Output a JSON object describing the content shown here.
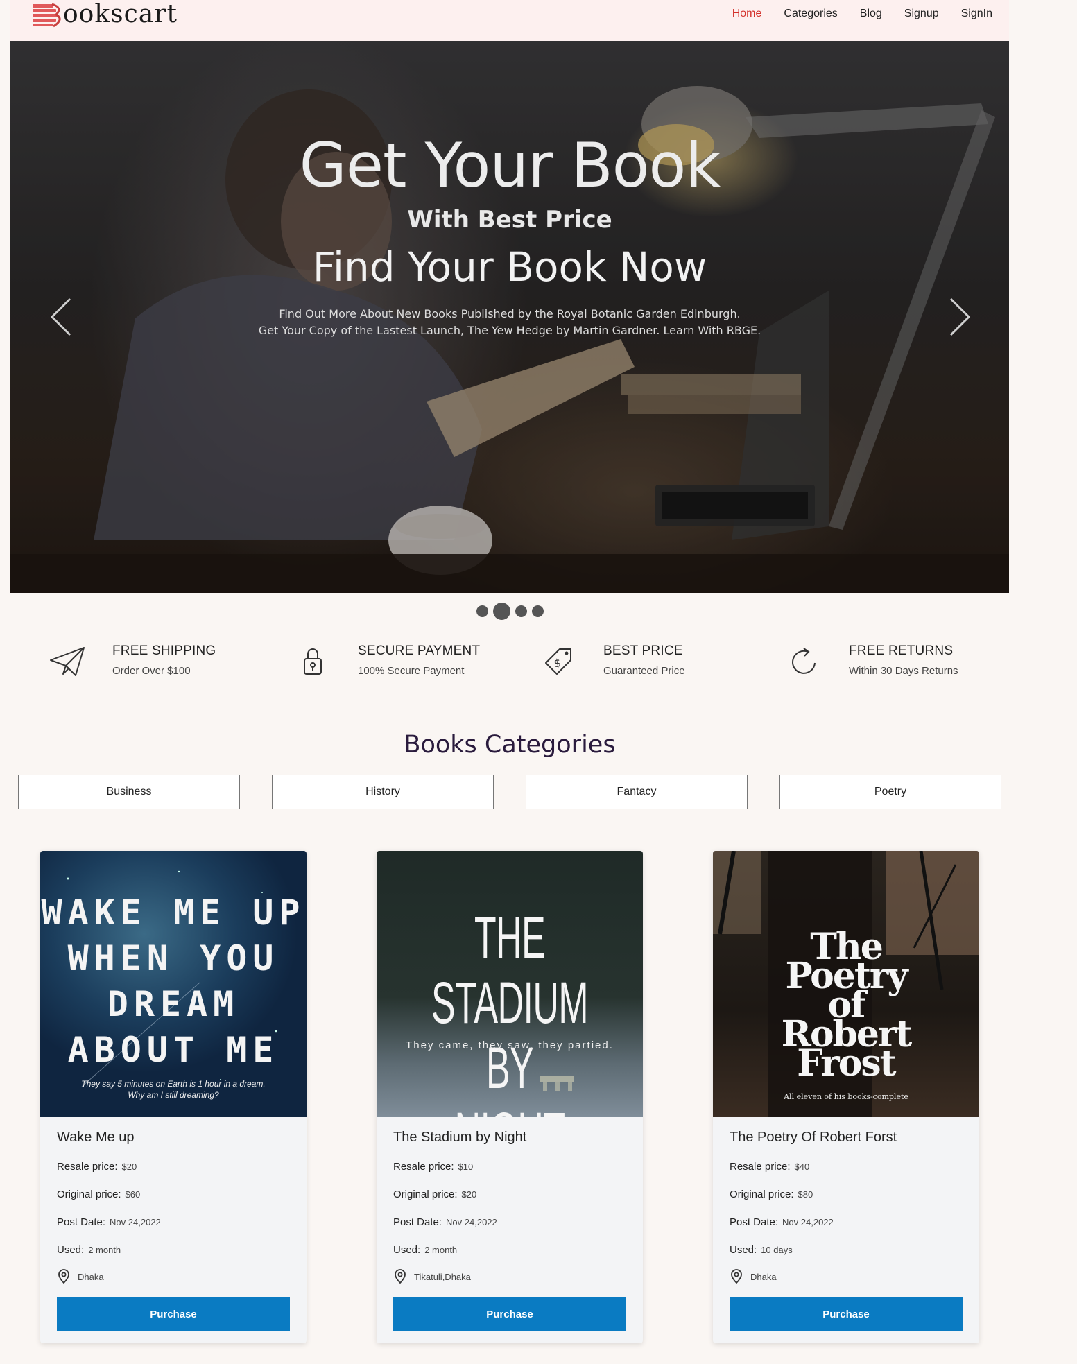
{
  "brand": {
    "name": "ookscart",
    "accent": "#d3302a"
  },
  "nav": {
    "items": [
      {
        "label": "Home",
        "active": true
      },
      {
        "label": "Categories",
        "active": false
      },
      {
        "label": "Blog",
        "active": false
      },
      {
        "label": "Signup",
        "active": false
      },
      {
        "label": "SignIn",
        "active": false
      }
    ]
  },
  "hero": {
    "title": "Get Your Book",
    "subtitle": "With Best Price",
    "tagline": "Find Your Book Now",
    "line1": "Find Out More About New Books Published by the Royal Botanic Garden Edinburgh.",
    "line2": "Get Your Copy of the Lastest Launch, The Yew Hedge by Martin Gardner. Learn With RBGE.",
    "slide_count": 4,
    "active_slide": 2
  },
  "features": [
    {
      "icon": "paper-plane-icon",
      "title": "FREE SHIPPING",
      "subtitle": "Order Over $100"
    },
    {
      "icon": "lock-icon",
      "title": "SECURE PAYMENT",
      "subtitle": "100% Secure Payment"
    },
    {
      "icon": "price-tag-icon",
      "title": "BEST PRICE",
      "subtitle": "Guaranteed Price"
    },
    {
      "icon": "refresh-icon",
      "title": "FREE RETURNS",
      "subtitle": "Within 30 Days Returns"
    }
  ],
  "categories": {
    "heading": "Books Categories",
    "items": [
      "Business",
      "History",
      "Fantacy",
      "Poetry"
    ]
  },
  "books": [
    {
      "cover_lines": [
        "WAKE ME UP",
        "WHEN YOU",
        "DREAM",
        "ABOUT ME"
      ],
      "cover_caption_1": "They say 5 minutes on Earth is 1 hour in a dream.",
      "cover_caption_2": "Why am I still dreaming?",
      "title": "Wake Me up",
      "resale_label": "Resale price:",
      "resale": "$20",
      "original_label": "Original price:",
      "original": "$60",
      "post_label": "Post Date:",
      "post_date": "Nov 24,2022",
      "used_label": "Used:",
      "used": "2 month",
      "location": "Dhaka",
      "button": "Purchase"
    },
    {
      "cover_lines": [
        "THE STADIUM",
        "BY NIGHT"
      ],
      "cover_caption_1": "They came, they saw, they partied.",
      "title": "The Stadium by Night",
      "resale_label": "Resale price:",
      "resale": "$10",
      "original_label": "Original price:",
      "original": "$20",
      "post_label": "Post Date:",
      "post_date": "Nov 24,2022",
      "used_label": "Used:",
      "used": "2 month",
      "location": "Tikatuli,Dhaka",
      "button": "Purchase"
    },
    {
      "cover_lines": [
        "The",
        "Poetry",
        "of",
        "Robert",
        "Frost"
      ],
      "cover_caption_1": "All eleven of his books-complete",
      "title": "The Poetry Of Robert Forst",
      "resale_label": "Resale price:",
      "resale": "$40",
      "original_label": "Original price:",
      "original": "$80",
      "post_label": "Post Date:",
      "post_date": "Nov 24,2022",
      "used_label": "Used:",
      "used": "10 days",
      "location": "Dhaka",
      "button": "Purchase"
    }
  ],
  "colors": {
    "button": "#0a7bc2",
    "header_bg": "#fdf0ef",
    "page_bg": "#faf6f3"
  }
}
